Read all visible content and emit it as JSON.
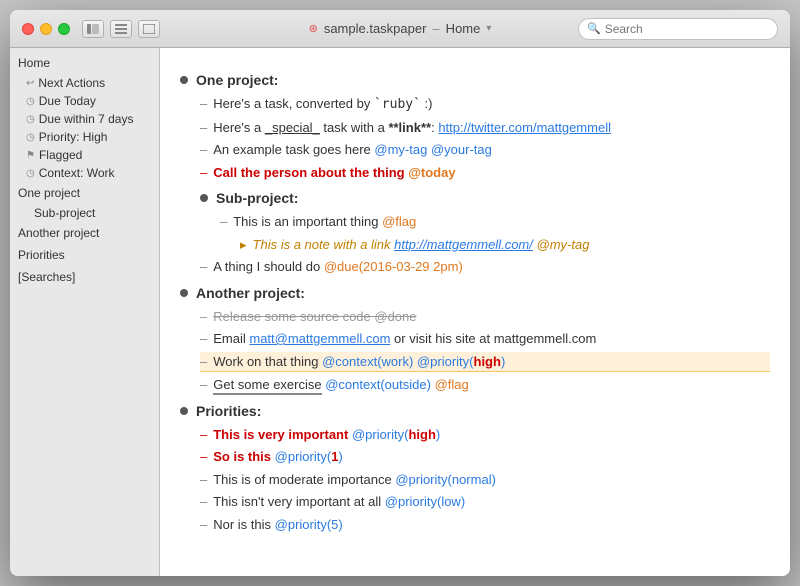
{
  "window": {
    "title": "sample.taskpaper",
    "subtitle": "Home",
    "search_placeholder": "Search"
  },
  "sidebar": {
    "home_label": "Home",
    "items": [
      {
        "id": "next-actions",
        "label": "Next Actions",
        "icon": "↩"
      },
      {
        "id": "due-today",
        "label": "Due Today",
        "icon": "◷"
      },
      {
        "id": "due-7days",
        "label": "Due within 7 days",
        "icon": "◷"
      },
      {
        "id": "priority-high",
        "label": "Priority: High",
        "icon": "◷"
      },
      {
        "id": "flagged",
        "label": "Flagged",
        "icon": "⚑"
      },
      {
        "id": "context-work",
        "label": "Context: Work",
        "icon": "◷"
      }
    ],
    "projects": [
      {
        "id": "one-project",
        "label": "One project"
      },
      {
        "id": "sub-project",
        "label": "Sub-project",
        "indent": true
      },
      {
        "id": "another-project",
        "label": "Another project"
      },
      {
        "id": "priorities",
        "label": "Priorities"
      },
      {
        "id": "searches",
        "label": "[Searches]"
      }
    ]
  },
  "content": {
    "projects": [
      {
        "id": "one-project",
        "heading": "One project:",
        "tasks": [
          {
            "id": "task-1",
            "text": "Here's a task, converted by `ruby` :)"
          },
          {
            "id": "task-2",
            "text": "Here's a _special_ task with a **link**:"
          },
          {
            "id": "task-3",
            "text": "An example task goes here"
          },
          {
            "id": "task-4",
            "text": "Call the person about the thing",
            "important": true
          }
        ],
        "subprojects": [
          {
            "id": "sub-project",
            "heading": "Sub-project:",
            "tasks": [
              {
                "id": "sub-task-1",
                "text": "This is an important thing"
              },
              {
                "id": "sub-task-note",
                "text": "This is a note with a link",
                "italic": true,
                "note": true
              },
              {
                "id": "sub-task-2",
                "text": "A thing I should do"
              }
            ]
          }
        ]
      },
      {
        "id": "another-project",
        "heading": "Another project:",
        "tasks": [
          {
            "id": "ap-task-1",
            "text": "Release some source code @done",
            "done": true
          },
          {
            "id": "ap-task-2",
            "text": "Email"
          },
          {
            "id": "ap-task-3",
            "text": "Work on that thing"
          },
          {
            "id": "ap-task-4",
            "text": "Get some exercise",
            "highlight": true
          }
        ]
      },
      {
        "id": "priorities",
        "heading": "Priorities:",
        "tasks": [
          {
            "id": "p-task-1",
            "text": "This is very important",
            "important": true
          },
          {
            "id": "p-task-2",
            "text": "So is this",
            "important": true
          },
          {
            "id": "p-task-3",
            "text": "This is of moderate importance"
          },
          {
            "id": "p-task-4",
            "text": "This isn't very important at all"
          }
        ]
      }
    ]
  },
  "icons": {
    "search": "🔍",
    "dot": "●"
  }
}
